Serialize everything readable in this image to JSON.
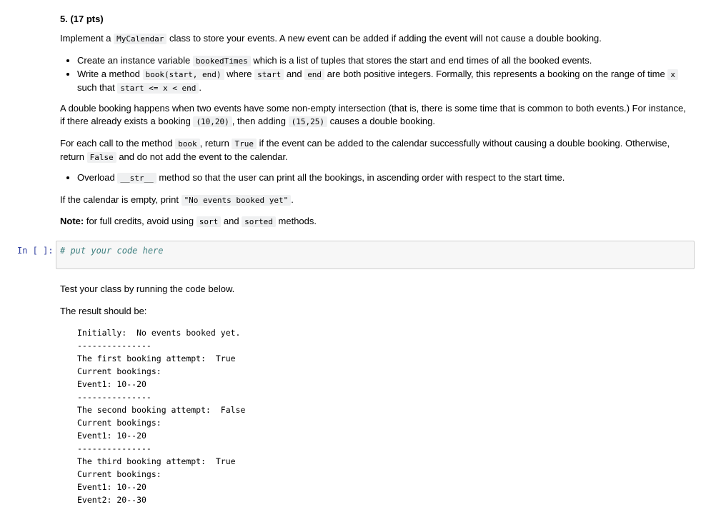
{
  "heading": "5. (17 pts)",
  "intro": [
    "Implement a ",
    "MyCalendar",
    " class to store your events. A new event can be added if adding the event will not cause a double booking."
  ],
  "bullets1": [
    [
      "Create an instance variable ",
      "bookedTimes",
      " which is a list of tuples that stores the start and end times of all the booked events."
    ],
    [
      "Write a method ",
      "book(start, end)",
      " where ",
      "start",
      " and ",
      "end",
      " are both positive integers. Formally, this represents a booking on the range of time ",
      "x",
      " such that ",
      "start <= x < end",
      "."
    ]
  ],
  "double": [
    "A double booking happens when two events have some non-empty intersection (that is, there is some time that is common to both events.) For instance, if there already exists a booking ",
    "(10,20)",
    ", then adding ",
    "(15,25)",
    " causes a double booking."
  ],
  "foreach": [
    "For each call to the method ",
    "book",
    ", return ",
    "True",
    " if the event can be added to the calendar successfully without causing a double booking. Otherwise, return ",
    "False",
    " and do not add the event to the calendar."
  ],
  "bullet2": [
    "Overload ",
    "__str__",
    " method so that the user can print all the bookings, in ascending order with respect to the start time."
  ],
  "empty": [
    "If the calendar is empty, print ",
    "\"No events booked yet\"",
    "."
  ],
  "note": [
    "Note:",
    " for full credits, avoid using ",
    "sort",
    " and ",
    "sorted",
    " methods."
  ],
  "cell": {
    "prompt": "In [ ]:",
    "code": "# put your code here"
  },
  "test": "Test your class by running the code below.",
  "result": "The result should be:",
  "output": "Initially:  No events booked yet.\n---------------\nThe first booking attempt:  True\nCurrent bookings:\nEvent1: 10--20\n---------------\nThe second booking attempt:  False\nCurrent bookings:\nEvent1: 10--20\n---------------\nThe third booking attempt:  True\nCurrent bookings:\nEvent1: 10--20\nEvent2: 20--30"
}
